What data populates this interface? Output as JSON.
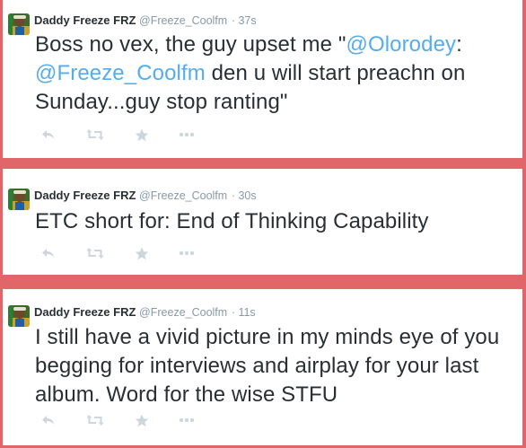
{
  "colors": {
    "background": "#e0666a",
    "card": "#ffffff",
    "text": "#292f33",
    "muted": "#8899a6",
    "link": "#55acee",
    "action_icon": "#ccd6dd"
  },
  "tweets": [
    {
      "name": "Daddy Freeze FRZ",
      "handle": "@Freeze_Coolfm",
      "time": "· 37s",
      "text_parts": [
        "Boss no vex, the guy upset me \"",
        "@Olorodey",
        ": ",
        "@Freeze_Coolfm",
        " den u will start preachn on Sunday...guy stop ranting\""
      ],
      "mentions": [
        "@Olorodey",
        "@Freeze_Coolfm"
      ],
      "actions": [
        "reply-icon",
        "retweet-icon",
        "favorite-icon",
        "more-icon"
      ]
    },
    {
      "name": "Daddy Freeze FRZ",
      "handle": "@Freeze_Coolfm",
      "time": "· 30s",
      "text": "ETC short for: End of Thinking Capability",
      "actions": [
        "reply-icon",
        "retweet-icon",
        "favorite-icon",
        "more-icon"
      ]
    },
    {
      "name": "Daddy Freeze FRZ",
      "handle": "@Freeze_Coolfm",
      "time": "· 11s",
      "text": "I still have a vivid picture in my minds eye of you begging for interviews and airplay for your last album. Word for the wise STFU",
      "actions": [
        "reply-icon",
        "retweet-icon",
        "favorite-icon",
        "more-icon"
      ]
    }
  ]
}
